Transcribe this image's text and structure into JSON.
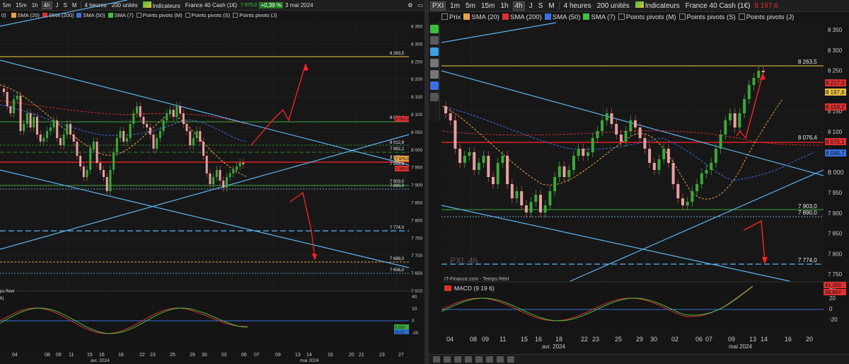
{
  "left": {
    "toolbar": {
      "tf": [
        "5m",
        "15m",
        "1h",
        "4h",
        "J",
        "S",
        "M"
      ],
      "period": "4 heures",
      "units": "200 unités",
      "indic": "Indicateurs",
      "instrument": "France 40 Cash (1€)",
      "price": "7 975,0",
      "change": "+0,39 %",
      "date": "3 mai 2024"
    },
    "legend": {
      "s1": "SMA (20)",
      "s2": "SMA (200)",
      "s3": "SMA (50)",
      "s4": "SMA (7)",
      "p1": "Points pivots (M)",
      "p2": "Points pivots (S)",
      "p3": "Points pivots (J)"
    },
    "prefix_left": [
      "0)",
      "S"
    ],
    "source": "ps Réel",
    "macd_prefix": "6)",
    "y_axis": [
      "8 350",
      "8 300",
      "8 250",
      "8 200",
      "8 150",
      "8 100",
      "8 050",
      "8 000",
      "7 950",
      "7 900",
      "7 850",
      "7 800",
      "7 750",
      "7 700",
      "7 650",
      "7 600"
    ],
    "levels": [
      "8 263,5",
      "8 081,0",
      "8 012,8",
      "7 992,2",
      "7 975,0",
      "7 957,0",
      "7 948,6",
      "7 903,0",
      "7 890,0",
      "7 774,0",
      "7 688,0",
      "7 656,0"
    ],
    "tags": [
      "8 082,8",
      "7 975,0",
      "7 948,6"
    ],
    "macd_axis": [
      "40",
      "20",
      "0",
      "-20"
    ],
    "macd_tags": [
      "0,010",
      "15,11"
    ],
    "x_days": [
      "04",
      "08",
      "09",
      "11",
      "15",
      "16",
      "18",
      "22",
      "23",
      "25",
      "29",
      "30",
      "02",
      "06",
      "07",
      "09",
      "13",
      "14",
      "16",
      "20",
      "21",
      "23",
      "27"
    ],
    "x_months": [
      "avr. 2024",
      "mai 2024"
    ]
  },
  "right": {
    "toolbar": {
      "prix": "PXI",
      "tf": [
        "1m",
        "5m",
        "15m",
        "1h",
        "4h",
        "J",
        "S",
        "M"
      ],
      "period": "4 heures",
      "units": "200 unités",
      "indic": "Indicateurs",
      "instrument": "France 40 Cash (1€)",
      "price": "8 197,6"
    },
    "legend": {
      "prix": "Prix",
      "s1": "SMA (20)",
      "s2": "SMA (200)",
      "s3": "SMA (50)",
      "s4": "SMA (7)",
      "p1": "Points pivots (M)",
      "p2": "Points pivots (S)",
      "p3": "Points pivots (J)"
    },
    "watermark": "PXI, 4h",
    "source": "IT-Finance.com - Temps Réel",
    "macd_label": "MACD (9 19 6)",
    "y_axis": [
      "8 350",
      "8 300",
      "8 250",
      "8 200",
      "8 150",
      "8 100",
      "8 050",
      "8 000",
      "7 950",
      "7 900",
      "7 850",
      "7 800",
      "7 750"
    ],
    "levels": [
      "8 263,5",
      "8 076,4",
      "7 903,0",
      "7 890,0",
      "7 774,0"
    ],
    "tags": [
      "8 217,0",
      "8 197,6",
      "8 159,2",
      "8 075,1",
      "8 045,7"
    ],
    "macd_axis": [
      "40",
      "20",
      "0",
      "-20"
    ],
    "macd_tags": [
      "41,359",
      "36,867"
    ],
    "x_days": [
      "04",
      "08",
      "09",
      "11",
      "15",
      "16",
      "18",
      "22",
      "23",
      "25",
      "29",
      "30",
      "02",
      "06",
      "07",
      "09",
      "13",
      "14",
      "16",
      "20"
    ],
    "x_months": [
      "avr. 2024",
      "mai 2024"
    ]
  },
  "colors": {
    "sma20": "#e8a040",
    "sma200": "#e03030",
    "sma50": "#3a6fe0",
    "sma7": "#40c040",
    "resistance": "#c8a838",
    "pivot_red": "#e02020",
    "pivot_green": "#3aa83a",
    "trend": "#5ab4f0",
    "arrow": "#ff2222"
  }
}
